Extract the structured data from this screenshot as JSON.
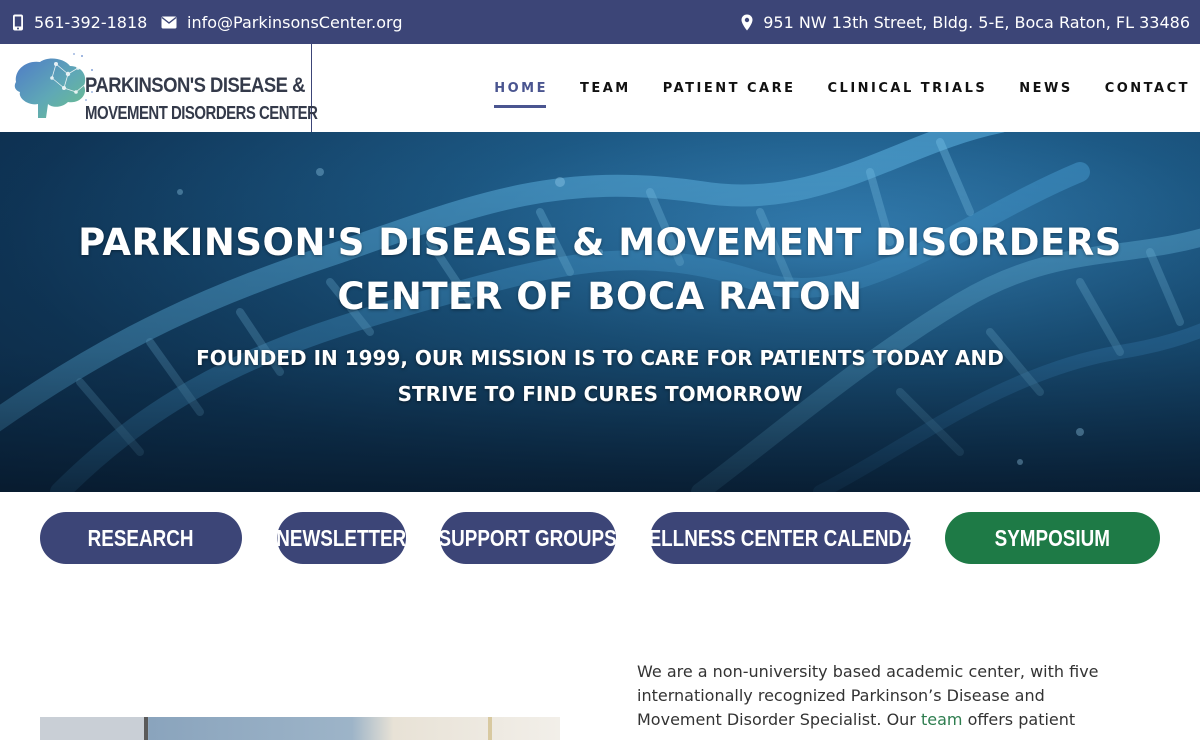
{
  "topbar": {
    "phone": "561-392-1818",
    "email": "info@ParkinsonsCenter.org",
    "address": "951 NW 13th Street, Bldg. 5-E, Boca Raton, FL 33486"
  },
  "logo": {
    "line1": "PARKINSON'S DISEASE &",
    "line2": "MOVEMENT DISORDERS CENTER"
  },
  "nav": {
    "items": [
      {
        "label": "HOME",
        "active": true
      },
      {
        "label": "TEAM"
      },
      {
        "label": "PATIENT CARE"
      },
      {
        "label": "CLINICAL TRIALS"
      },
      {
        "label": "NEWS"
      },
      {
        "label": "CONTACT"
      }
    ]
  },
  "hero": {
    "title_line1": "PARKINSON'S DISEASE & MOVEMENT DISORDERS",
    "title_line2": "CENTER OF BOCA RATON",
    "subtitle_line1": "FOUNDED IN 1999, OUR MISSION IS TO CARE FOR PATIENTS TODAY AND",
    "subtitle_line2": "STRIVE TO FIND CURES TOMORROW"
  },
  "buttons": [
    {
      "label": "RESEARCH"
    },
    {
      "label": "NEWSLETTER"
    },
    {
      "label": "SUPPORT GROUPS"
    },
    {
      "label": "WELLNESS CENTER CALENDAR"
    },
    {
      "label": "SYMPOSIUM"
    }
  ],
  "intro": {
    "line1": "We are a non-university based academic center, with five",
    "line2": "internationally recognized Parkinson’s Disease and",
    "line3_prefix": "Movement Disorder Specialist. Our ",
    "line3_link": "team",
    "line3_suffix": " offers patient"
  },
  "colors": {
    "brand_navy": "#3c4577",
    "symposium_green": "#1e7a46",
    "active_nav": "#4a5590",
    "link_green": "#2e7d4f"
  },
  "icons": {
    "phone": "mobile-phone-icon",
    "email": "envelope-icon",
    "address": "map-marker-icon",
    "logo": "brain-icon"
  }
}
